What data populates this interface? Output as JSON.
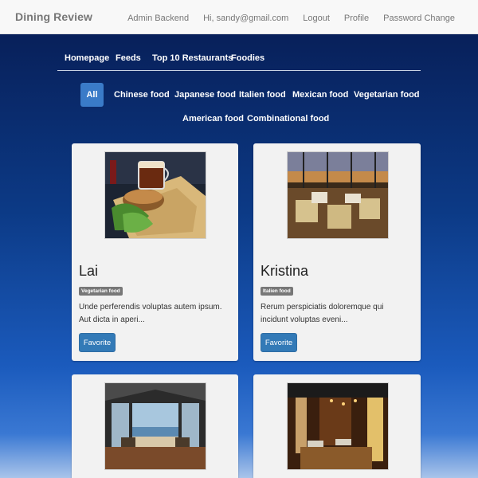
{
  "header": {
    "brand": "Dining Review",
    "links": [
      "Admin Backend",
      "Hi, sandy@gmail.com",
      "Logout",
      "Profile",
      "Password Change"
    ]
  },
  "mainnav": [
    "Homepage",
    "Feeds",
    "Top 10 Restaurants",
    "Foodies"
  ],
  "categories": [
    "All",
    "Chinese food",
    "Japanese food",
    "Italien food",
    "Mexican food",
    "Vegetarian food",
    "American food",
    "Combinational food"
  ],
  "cards": [
    {
      "title": "Lai",
      "badge": "Vegetarian food",
      "desc": "Unde perferendis voluptas autem ipsum. Aut dicta in aperi...",
      "button": "Favorite"
    },
    {
      "title": "Kristina",
      "badge": "Italien food",
      "desc": "Rerum perspiciatis doloremque qui incidunt voluptas eveni...",
      "button": "Favorite"
    },
    {
      "title": "",
      "badge": "",
      "desc": "",
      "button": ""
    },
    {
      "title": "",
      "badge": "",
      "desc": "",
      "button": ""
    }
  ]
}
